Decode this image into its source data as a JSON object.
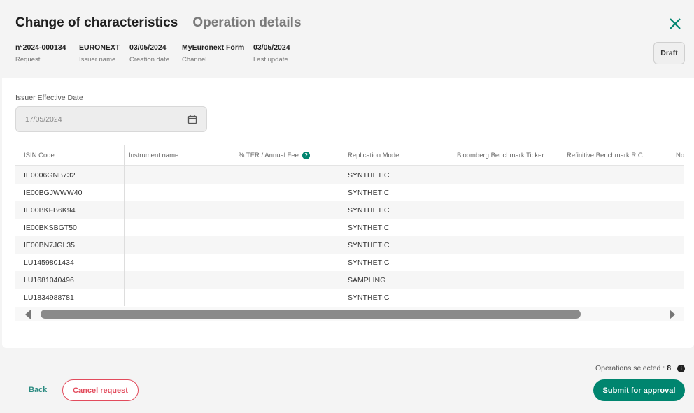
{
  "header": {
    "title": "Change of characteristics",
    "subtitle": "Operation details",
    "status": "Draft",
    "meta": [
      {
        "value": "n°2024-000134",
        "label": "Request"
      },
      {
        "value": "EURONEXT",
        "label": "Issuer name"
      },
      {
        "value": "03/05/2024",
        "label": "Creation date"
      },
      {
        "value": "MyEuronext Form",
        "label": "Channel"
      },
      {
        "value": "03/05/2024",
        "label": "Last update"
      }
    ]
  },
  "form": {
    "effective_date_label": "Issuer Effective Date",
    "effective_date_value": "17/05/2024"
  },
  "table": {
    "columns": [
      "ISIN Code",
      "Instrument name",
      "% TER / Annual Fee",
      "Replication Mode",
      "Bloomberg Benchmark Ticker",
      "Refinitive Benchmark RIC",
      "No"
    ],
    "rows": [
      [
        "IE0006GNB732",
        "",
        "",
        "SYNTHETIC",
        "",
        ""
      ],
      [
        "IE00BGJWWW40",
        "",
        "",
        "SYNTHETIC",
        "",
        ""
      ],
      [
        "IE00BKFB6K94",
        "",
        "",
        "SYNTHETIC",
        "",
        ""
      ],
      [
        "IE00BKSBGT50",
        "",
        "",
        "SYNTHETIC",
        "",
        ""
      ],
      [
        "IE00BN7JGL35",
        "",
        "",
        "SYNTHETIC",
        "",
        ""
      ],
      [
        "LU1459801434",
        "",
        "",
        "SYNTHETIC",
        "",
        ""
      ],
      [
        "LU1681040496",
        "",
        "",
        "SAMPLING",
        "",
        ""
      ],
      [
        "LU1834988781",
        "",
        "",
        "SYNTHETIC",
        "",
        ""
      ]
    ]
  },
  "footer": {
    "ops_label": "Operations selected :",
    "ops_count": "8",
    "back": "Back",
    "cancel": "Cancel request",
    "submit": "Submit for approval"
  },
  "colors": {
    "accent": "#00856f",
    "danger": "#e24b5c"
  },
  "icons": {
    "close": "close-icon",
    "calendar": "calendar-icon",
    "help": "help-icon",
    "info": "info-icon"
  }
}
